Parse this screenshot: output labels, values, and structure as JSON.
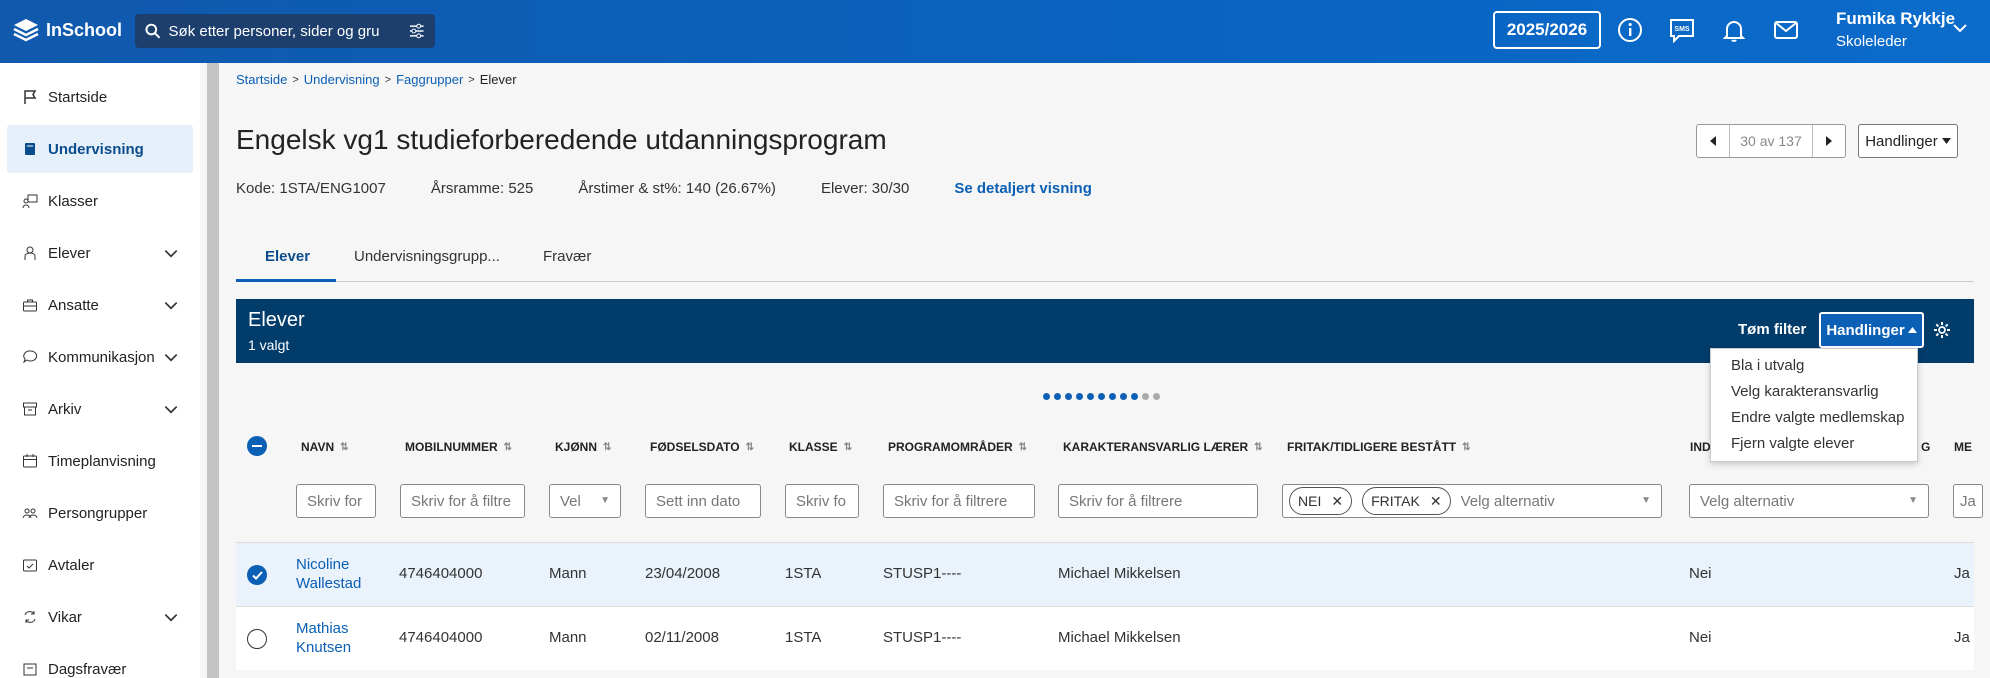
{
  "header": {
    "logo_text": "InSchool",
    "search_placeholder": "Søk etter personer, sider og gru",
    "year": "2025/2026",
    "user_name": "Fumika Rykkje",
    "user_role": "Skoleleder",
    "icons": [
      "info-icon",
      "sms-icon",
      "bell-icon",
      "mail-icon"
    ]
  },
  "sidebar": {
    "items": [
      {
        "label": "Startside",
        "icon": "flag-icon"
      },
      {
        "label": "Undervisning",
        "icon": "book-icon",
        "active": true
      },
      {
        "label": "Klasser",
        "icon": "classes-icon"
      },
      {
        "label": "Elever",
        "icon": "students-icon",
        "expandable": true
      },
      {
        "label": "Ansatte",
        "icon": "briefcase-icon",
        "expandable": true
      },
      {
        "label": "Kommunikasjon",
        "icon": "chat-icon",
        "expandable": true
      },
      {
        "label": "Arkiv",
        "icon": "archive-icon",
        "expandable": true
      },
      {
        "label": "Timeplanvisning",
        "icon": "calendar-icon"
      },
      {
        "label": "Persongrupper",
        "icon": "group-icon"
      },
      {
        "label": "Avtaler",
        "icon": "calendar-check-icon"
      },
      {
        "label": "Vikar",
        "icon": "swap-icon",
        "expandable": true
      },
      {
        "label": "Dagsfravær",
        "icon": "absence-icon"
      }
    ]
  },
  "breadcrumb": [
    "Startside",
    "Undervisning",
    "Faggrupper",
    "Elever"
  ],
  "page": {
    "title": "Engelsk vg1 studieforberedende utdanningsprogram",
    "kode": "Kode: 1STA/ENG1007",
    "arsramme": "Årsramme: 525",
    "arstimer": "Årstimer & st%: 140 (26.67%)",
    "elever": "Elever: 30/30",
    "detail_link": "Se detaljert visning",
    "pager": "30 av 137",
    "actions": "Handlinger"
  },
  "tabs": [
    "Elever",
    "Undervisningsgrupp...",
    "Fravær"
  ],
  "panel": {
    "title": "Elever",
    "subtitle": "1 valgt",
    "clear_filter": "Tøm filter",
    "actions": "Handlinger"
  },
  "columns": [
    "NAVN",
    "MOBILNUMMER",
    "KJØNN",
    "FØDSELSDATO",
    "KLASSE",
    "PROGRAMOMRÅDER",
    "KARAKTERANSVARLIG LÆRER",
    "FRITAK/TIDLIGERE BESTÅTT",
    "IND",
    "G",
    "ME"
  ],
  "filters": {
    "navn": "Skriv for",
    "mobil": "Skriv for å filtre",
    "kjonn": "Vel",
    "fodsel": "Sett inn dato",
    "klasse": "Skriv fo",
    "program": "Skriv for å filtrere",
    "laerer": "Skriv for å filtrere",
    "fritak_chip1": "NEI",
    "fritak_chip2": "FRITAK",
    "fritak_placeholder": "Velg alternativ",
    "ind_placeholder": "Velg alternativ",
    "me": "Ja"
  },
  "rows": [
    {
      "name1": "Nicoline",
      "name2": "Wallestad",
      "mobil": "4746404000",
      "kjonn": "Mann",
      "fodsel": "23/04/2008",
      "klasse": "1STA",
      "program": "STUSP1----",
      "laerer": "Michael Mikkelsen",
      "ind": "Nei",
      "me": "Ja",
      "selected": true
    },
    {
      "name1": "Mathias",
      "name2": "Knutsen",
      "mobil": "4746404000",
      "kjonn": "Mann",
      "fodsel": "02/11/2008",
      "klasse": "1STA",
      "program": "STUSP1----",
      "laerer": "Michael Mikkelsen",
      "ind": "Nei",
      "me": "Ja",
      "selected": false
    }
  ],
  "menu": [
    "Bla i utvalg",
    "Velg karakteransvarlig",
    "Endre valgte medlemskap",
    "Fjern valgte elever"
  ],
  "colors": {
    "primary": "#0b5fb5",
    "panel": "#023c6b",
    "header": "#1059ad"
  }
}
